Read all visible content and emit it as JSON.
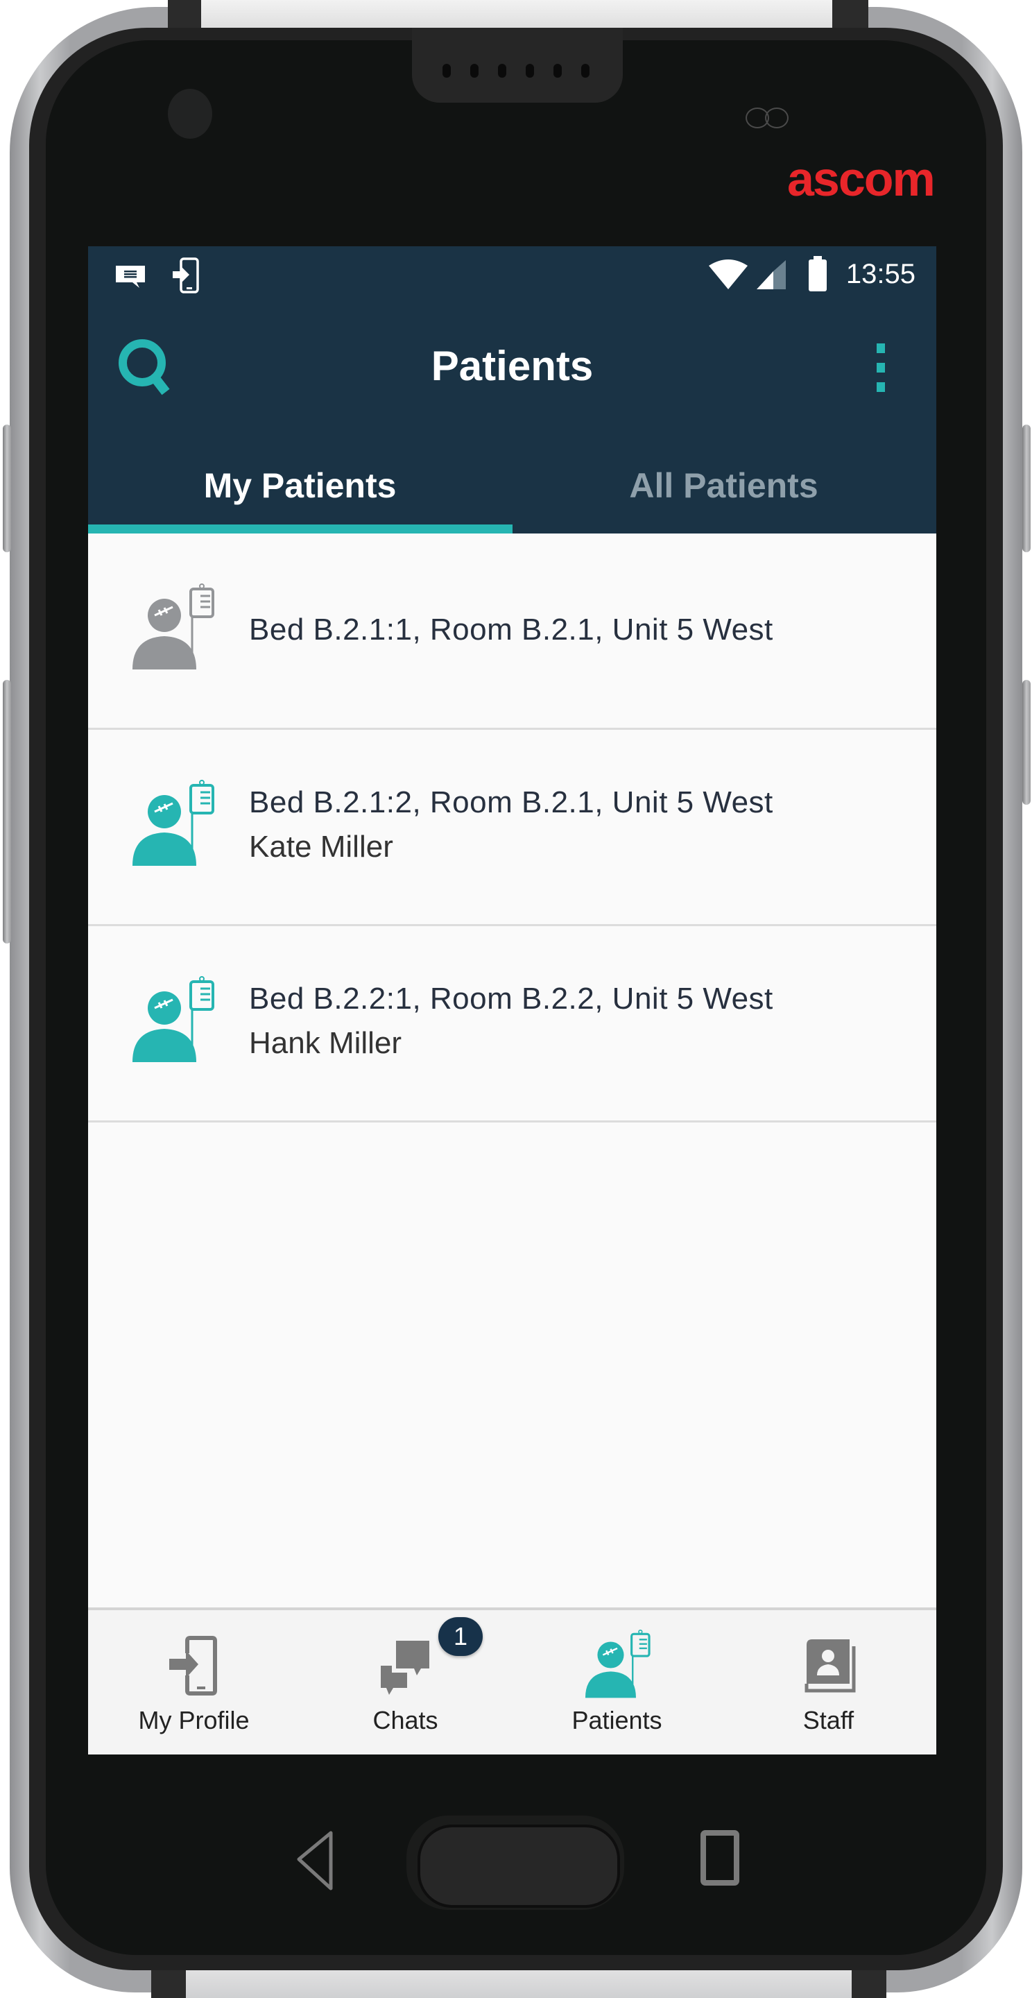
{
  "device": {
    "brand": "ascom",
    "brand_color": "#e8262a"
  },
  "status_bar": {
    "notification_icons": [
      "message-icon",
      "login-phone-icon"
    ],
    "system_icons": [
      "wifi-icon",
      "cellular-signal-icon",
      "battery-icon"
    ],
    "time": "13:55"
  },
  "header": {
    "title": "Patients",
    "search_icon": "search-icon",
    "menu_icon": "more-vertical-icon",
    "background": "#1a3345",
    "accent": "#26b5b2"
  },
  "tabs": [
    {
      "label": "My Patients",
      "active": true
    },
    {
      "label": "All Patients",
      "active": false
    }
  ],
  "patients": [
    {
      "location": "Bed B.2.1:1, Room B.2.1, Unit 5 West",
      "name": "",
      "icon": "patient-iv-icon",
      "icon_color": "#939598"
    },
    {
      "location": "Bed B.2.1:2, Room B.2.1, Unit 5 West",
      "name": "Kate Miller",
      "icon": "patient-iv-icon",
      "icon_color": "#26b5b2"
    },
    {
      "location": "Bed B.2.2:1, Room B.2.2, Unit 5 West",
      "name": "Hank Miller",
      "icon": "patient-iv-icon",
      "icon_color": "#26b5b2"
    }
  ],
  "bottom_nav": [
    {
      "label": "My Profile",
      "icon": "login-phone-icon",
      "active": false
    },
    {
      "label": "Chats",
      "icon": "chats-icon",
      "active": false,
      "badge": "1"
    },
    {
      "label": "Patients",
      "icon": "patient-iv-icon",
      "active": true
    },
    {
      "label": "Staff",
      "icon": "contacts-book-icon",
      "active": false
    }
  ],
  "hardware_nav": [
    "back-icon",
    "home-button",
    "recents-icon"
  ]
}
